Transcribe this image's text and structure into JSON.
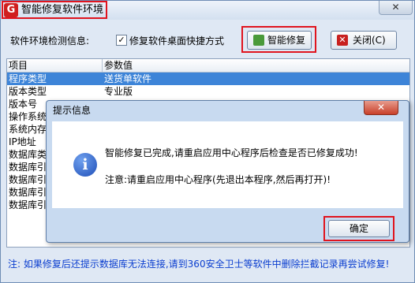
{
  "window": {
    "title": "智能修复软件环境",
    "close_label": "✕",
    "app_icon_glyph": "G"
  },
  "toolbar": {
    "detect_label": "软件环境检测信息:",
    "checkbox_checked": true,
    "checkbox_label": "修复软件桌面快捷方式",
    "repair_label": "智能修复",
    "close_label": "关闭(C)"
  },
  "table": {
    "headers": [
      "项目",
      "参数值"
    ],
    "rows": [
      {
        "item": "程序类型",
        "value": "送货单软件"
      },
      {
        "item": "版本类型",
        "value": "专业版"
      },
      {
        "item": "版本号",
        "value": ""
      },
      {
        "item": "操作系统",
        "value": ""
      },
      {
        "item": "系统内存",
        "value": ""
      },
      {
        "item": "IP地址",
        "value": ""
      },
      {
        "item": "数据库类",
        "value": ""
      },
      {
        "item": "数据库引",
        "value": ""
      },
      {
        "item": "数据库引",
        "value": ""
      },
      {
        "item": "数据库引",
        "value": ""
      },
      {
        "item": "数据库引",
        "value": ""
      }
    ],
    "selected_row": 0
  },
  "footer": {
    "note": "注: 如果修复后还提示数据库无法连接,请到360安全卫士等软件中删除拦截记录再尝试修复!"
  },
  "dialog": {
    "title": "提示信息",
    "close_label": "✕",
    "message": "智能修复已完成,请重启应用中心程序后检查是否已修复成功!",
    "note": "注意:请重启应用中心程序(先退出本程序,然后再打开)!",
    "ok_label": "确定"
  },
  "colors": {
    "highlight": "#e0141e",
    "selection": "#3d84d8",
    "footer_text": "#0b3ecf"
  }
}
